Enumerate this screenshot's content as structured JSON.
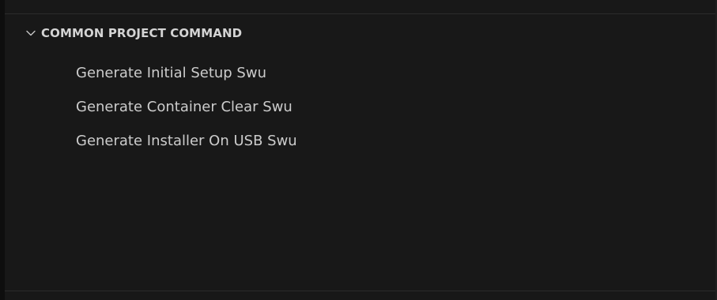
{
  "section": {
    "title": "COMMON PROJECT COMMAND",
    "expanded": true,
    "chevron_icon": "chevron-down-icon"
  },
  "items": [
    {
      "label": "Generate Initial Setup Swu"
    },
    {
      "label": "Generate Container Clear Swu"
    },
    {
      "label": "Generate Installer On USB Swu"
    }
  ],
  "colors": {
    "background": "#181818",
    "header_text": "#d4d4d4",
    "item_text": "#cccccc",
    "divider": "#2b2b2b"
  }
}
